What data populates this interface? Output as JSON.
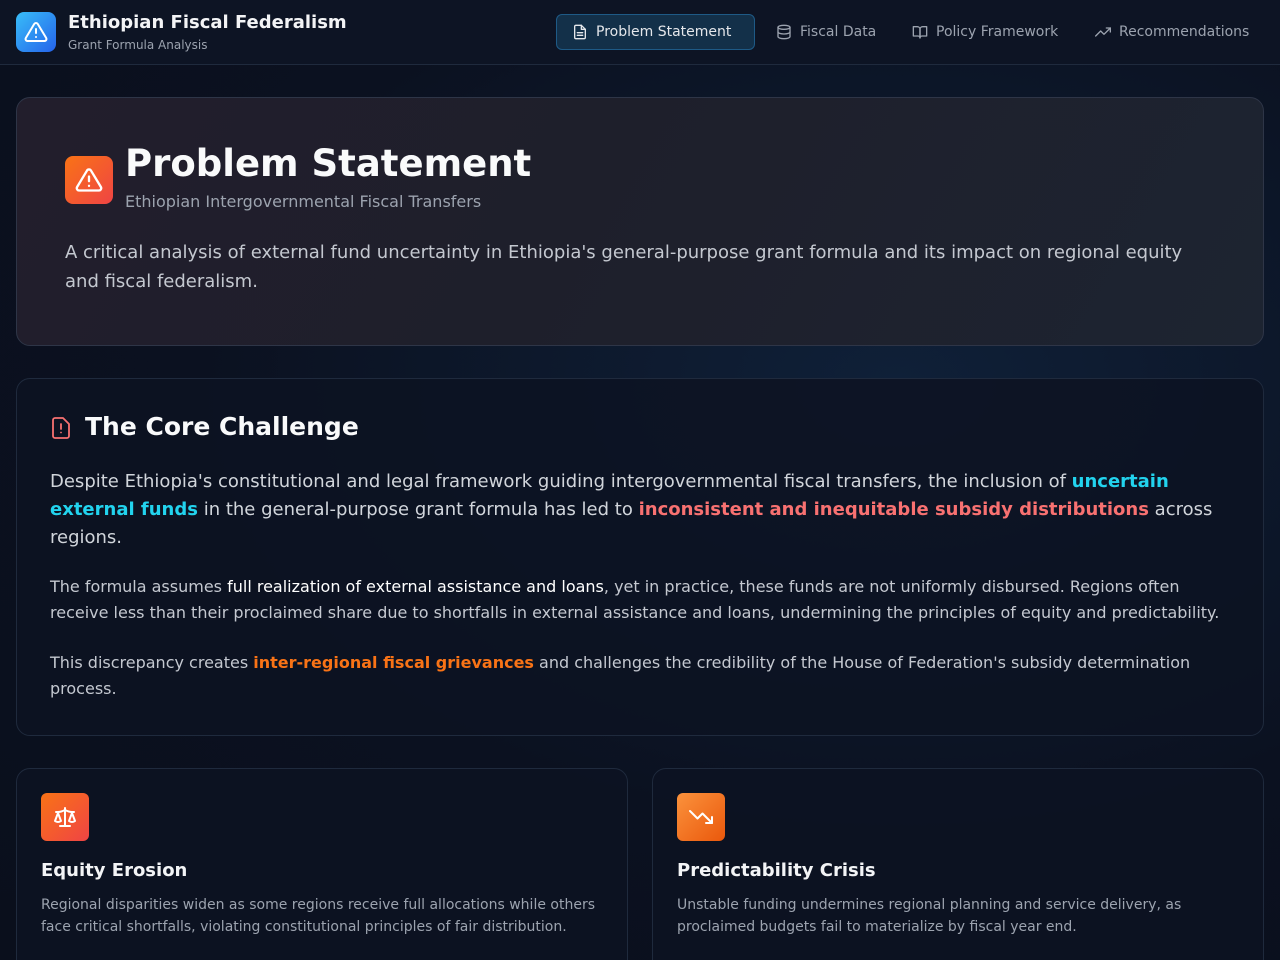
{
  "header": {
    "title": "Ethiopian Fiscal Federalism",
    "subtitle": "Grant Formula Analysis",
    "nav": [
      {
        "label": "Problem Statement",
        "icon": "file-text-icon",
        "active": true
      },
      {
        "label": "Fiscal Data",
        "icon": "database-icon",
        "active": false
      },
      {
        "label": "Policy Framework",
        "icon": "book-open-icon",
        "active": false
      },
      {
        "label": "Recommendations",
        "icon": "trending-up-icon",
        "active": false
      }
    ]
  },
  "hero": {
    "icon": "alert-triangle-icon",
    "title": "Problem Statement",
    "subtitle": "Ethiopian Intergovernmental Fiscal Transfers",
    "description": "A critical analysis of external fund uncertainty in Ethiopia's general-purpose grant formula and its impact on regional equity and fiscal federalism."
  },
  "core": {
    "icon": "file-alert-icon",
    "title": "The Core Challenge",
    "lead": {
      "part1": "Despite Ethiopia's constitutional and legal framework guiding intergovernmental fiscal transfers, the inclusion of ",
      "highlight1": "uncertain external funds",
      "part2": " in the general-purpose grant formula has led to ",
      "highlight2": "inconsistent and inequitable subsidy distributions",
      "part3": " across regions."
    },
    "para2": {
      "part1": "The formula assumes ",
      "highlight": "full realization of external assistance and loans",
      "part2": ", yet in practice, these funds are not uniformly disbursed. Regions often receive less than their proclaimed share due to shortfalls in external assistance and loans, undermining the principles of equity and predictability."
    },
    "para3": {
      "part1": "This discrepancy creates ",
      "highlight": "inter-regional fiscal grievances",
      "part2": " and challenges the credibility of the House of Federation's subsidy determination process."
    }
  },
  "cards": [
    {
      "icon": "scale-icon",
      "color": "#ef4444",
      "title": "Equity Erosion",
      "description": "Regional disparities widen as some regions receive full allocations while others face critical shortfalls, violating constitutional principles of fair distribution."
    },
    {
      "icon": "trending-down-icon",
      "color": "#f97316",
      "title": "Predictability Crisis",
      "description": "Unstable funding undermines regional planning and service delivery, as proclaimed budgets fail to materialize by fiscal year end."
    }
  ],
  "colors": {
    "accent_blue": "#22d3ee",
    "accent_red": "#f87171",
    "accent_orange": "#f97316",
    "active_nav_bg": "#133049"
  }
}
